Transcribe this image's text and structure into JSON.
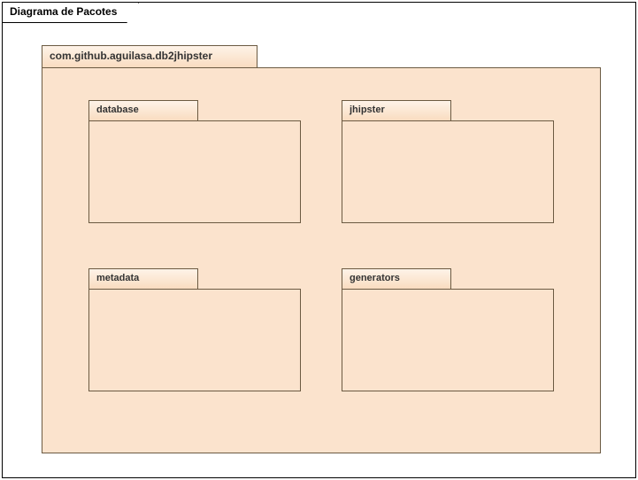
{
  "diagram": {
    "title": "Diagrama de Pacotes",
    "rootPackage": "com.github.aguilasa.db2jhipster",
    "packages": {
      "topLeft": "database",
      "topRight": "jhipster",
      "bottomLeft": "metadata",
      "bottomRight": "generators"
    }
  }
}
